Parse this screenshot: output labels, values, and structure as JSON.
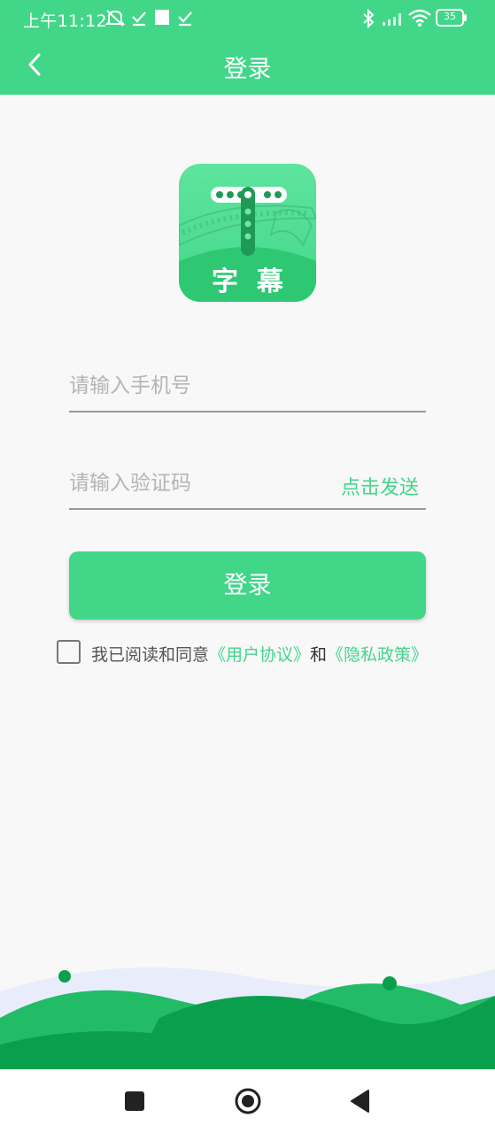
{
  "status_bar": {
    "time": "上午11:12",
    "battery": "35",
    "icons": [
      "notification-off-icon",
      "check-icon",
      "square-icon",
      "check-icon",
      "bluetooth-icon",
      "signal-icon",
      "wifi-icon",
      "battery-icon"
    ]
  },
  "header": {
    "title": "登录",
    "back_icon": "chevron-left-icon"
  },
  "logo": {
    "text": "字  幕",
    "colors": {
      "bg_top": "#5ee49e",
      "bg_bottom": "#2ec873",
      "accent": "#1f9a56"
    }
  },
  "form": {
    "phone": {
      "value": "",
      "placeholder": "请输入手机号"
    },
    "code": {
      "value": "",
      "placeholder": "请输入验证码"
    },
    "send_label": "点击发送",
    "login_label": "登录"
  },
  "agreement": {
    "checked": false,
    "prefix": "我已阅读和同意",
    "user_agreement": "《用户协议》",
    "joiner": "和",
    "privacy_policy": "《隐私政策》"
  },
  "colors": {
    "brand": "#42d689",
    "hill_dark": "#0a9f4c",
    "hill_mid": "#22bb66",
    "hill_back": "#e9ecfb"
  },
  "nav": {
    "icons": [
      "recents-square-icon",
      "home-circle-icon",
      "back-triangle-icon"
    ]
  }
}
